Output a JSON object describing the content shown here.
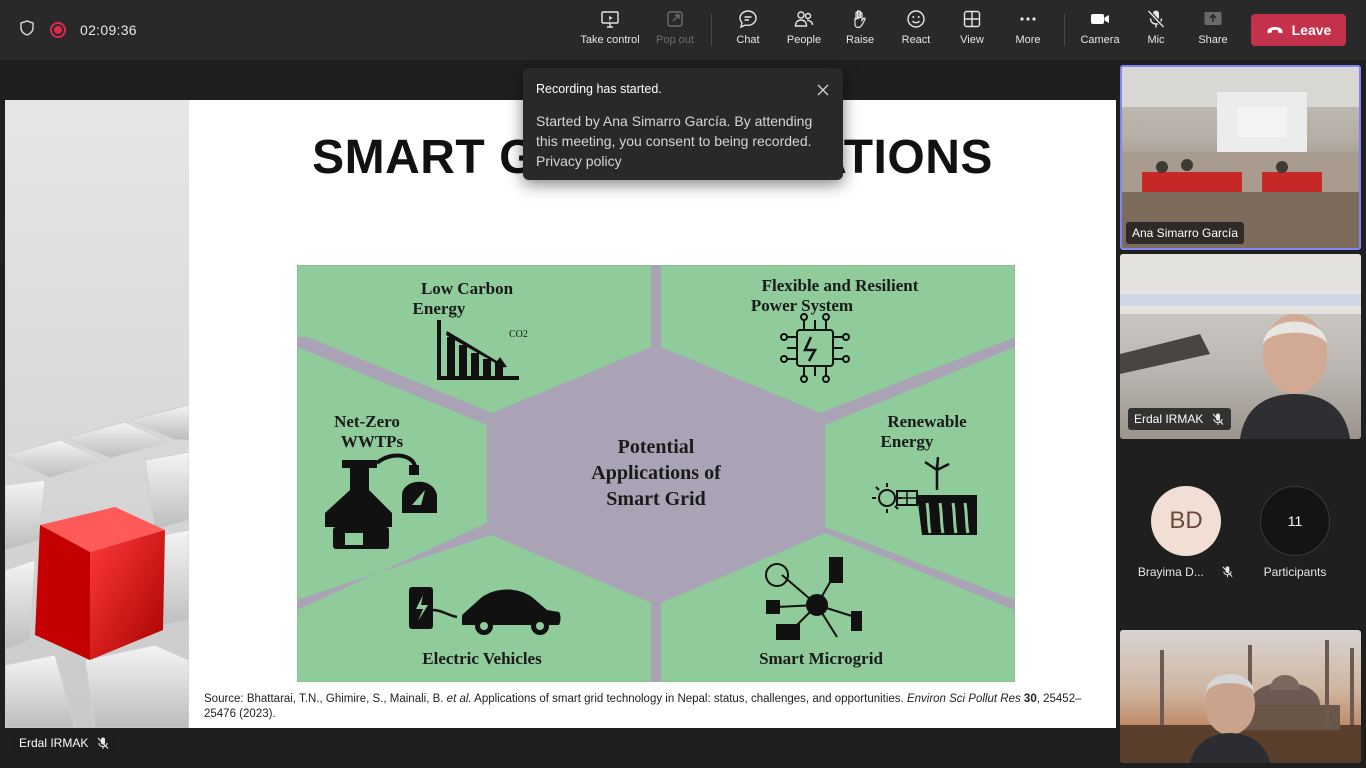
{
  "meeting": {
    "timer": "02:09:36"
  },
  "toolbar": {
    "take_control": "Take control",
    "pop_out": "Pop out",
    "chat": "Chat",
    "people": "People",
    "raise": "Raise",
    "react": "React",
    "view": "View",
    "more": "More",
    "camera": "Camera",
    "mic": "Mic",
    "share": "Share",
    "leave": "Leave"
  },
  "toast": {
    "title": "Recording has started.",
    "body": "Started by Ana Simarro García. By attending this meeting, you consent to being recorded.",
    "link": "Privacy policy"
  },
  "slide": {
    "title": "SMART GRID APPLICATIONS",
    "diagram": {
      "center": [
        "Potential",
        "Applications of",
        "Smart Grid"
      ],
      "segments": {
        "top_left": [
          "Low Carbon",
          "Energy"
        ],
        "top_right": [
          "Flexible and Resilient",
          "Power System"
        ],
        "mid_left": [
          "Net-Zero",
          "WWTPs"
        ],
        "mid_right": [
          "Renewable",
          "Energy"
        ],
        "bottom_left": [
          "Electric Vehicles"
        ],
        "bottom_right": [
          "Smart Microgrid"
        ]
      },
      "co2_label": "CO2"
    },
    "source_prefix": "Source: Bhattarai, T.N., Ghimire, S., Mainali, B. ",
    "source_etal": "et al.",
    "source_middle": " Applications of smart grid technology in Nepal: status, challenges, and opportunities. ",
    "source_journal": "Environ Sci Pollut Res",
    "source_volume": " 30",
    "source_pages": ", 25452–25476 (2023)."
  },
  "stage": {
    "presenter_name": "Erdal IRMAK"
  },
  "participants": {
    "tile1_name": "Ana Simarro García",
    "tile2_name": "Erdal IRMAK",
    "avatar_initials": "BD",
    "avatar_name": "Brayima D...",
    "count": "11",
    "count_label": "Participants"
  },
  "colors": {
    "accent": "#7f85f5",
    "leave": "#c4314b",
    "recording": "#e0284f",
    "diagram_green": "#8fcb9b",
    "diagram_gray": "#a9a3b5",
    "avatar_bg": "#f1dfd6"
  }
}
